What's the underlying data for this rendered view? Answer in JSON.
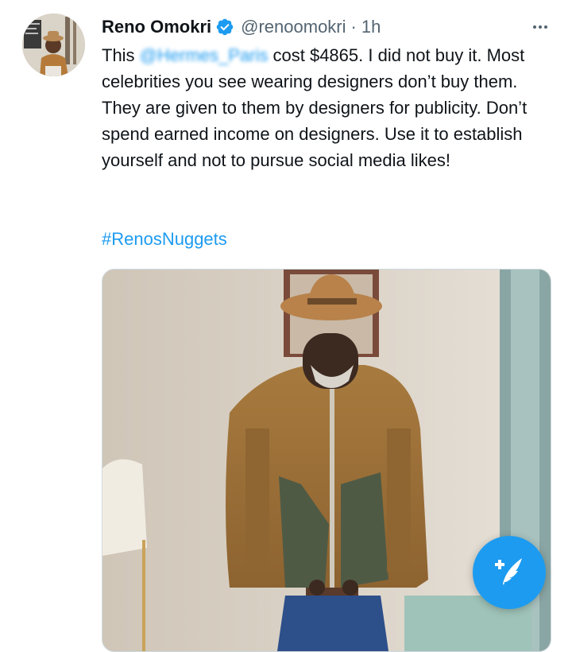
{
  "tweet": {
    "author": {
      "display_name": "Reno Omokri",
      "handle": "@renoomokri",
      "verified": true
    },
    "separator": "·",
    "time": "1h",
    "body": {
      "prefix": "This ",
      "mention": "@Hermes_Paris",
      "rest": " cost $4865. I did not buy it. Most celebrities you see wearing designers don’t buy them. They are given to them by designers for publicity. Don’t spend earned income on designers. Use it to establish yourself and not to pursue social media likes!"
    },
    "hashtag": "#RenosNuggets"
  },
  "icons": {
    "verified": "verified-badge-icon",
    "more": "more-options-icon",
    "compose": "compose-tweet-icon"
  },
  "colors": {
    "link": "#1d9bf0",
    "text_primary": "#0f1419",
    "text_secondary": "#536471",
    "fab": "#1d9bf0"
  }
}
